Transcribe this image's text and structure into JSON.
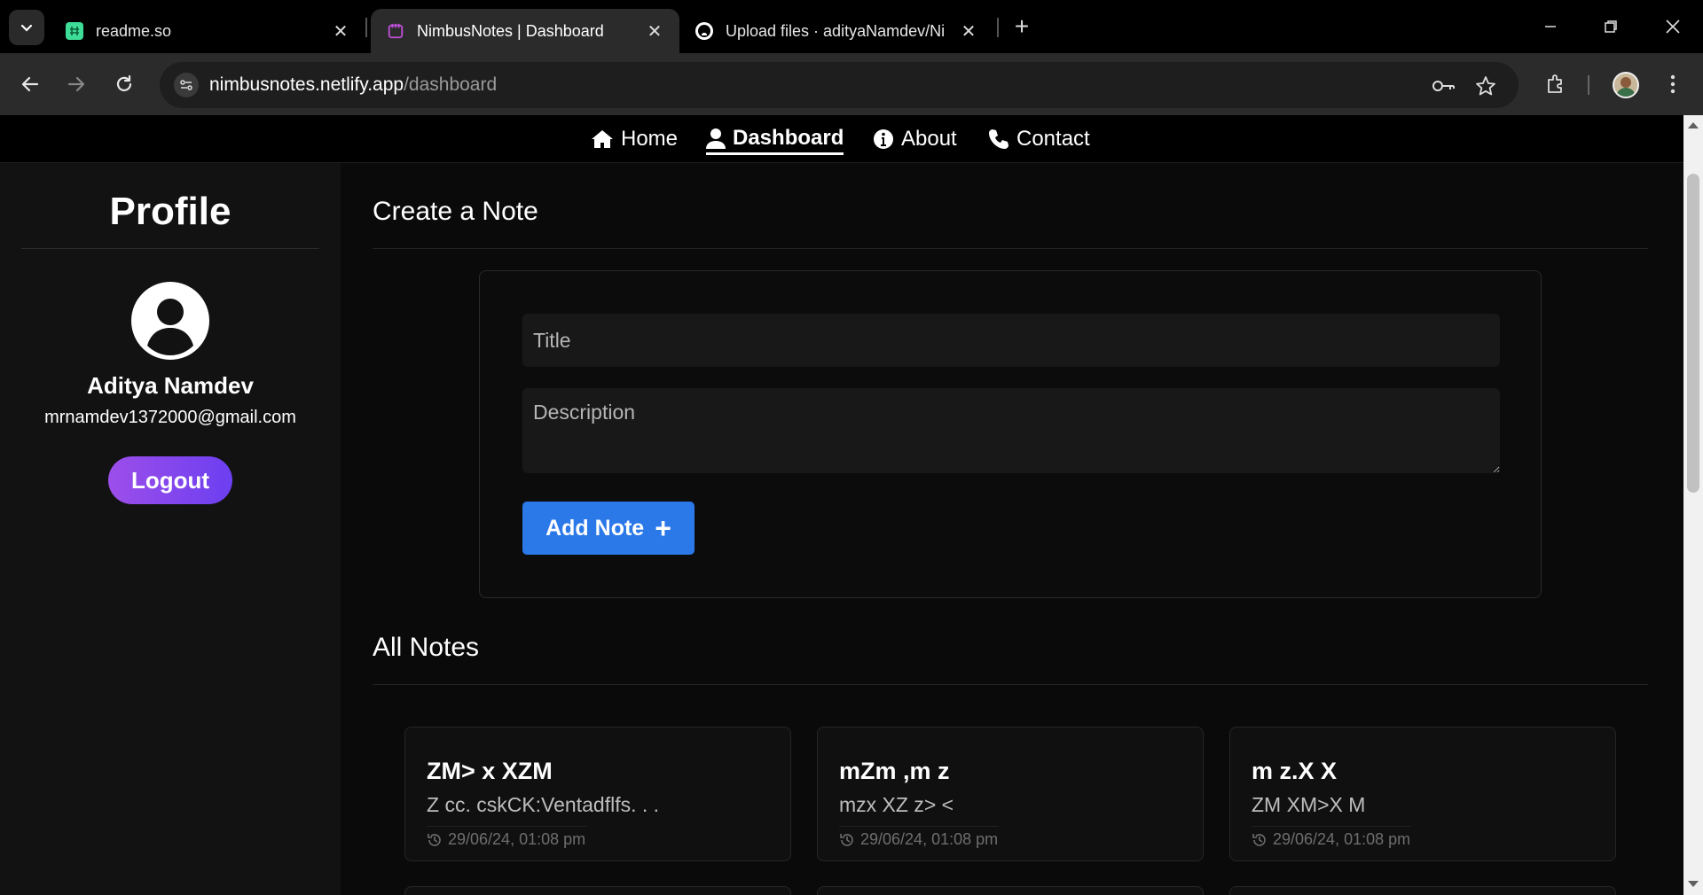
{
  "browser": {
    "tabs": [
      {
        "title": "readme.so",
        "close": "✕"
      },
      {
        "title": "NimbusNotes | Dashboard",
        "close": "✕"
      },
      {
        "title": "Upload files · adityaNamdev/Ni",
        "close": "✕"
      }
    ],
    "new_tab": "+",
    "url": {
      "domain": "nimbusnotes.netlify.app",
      "path": "/dashboard"
    }
  },
  "nav": {
    "home": "Home",
    "dashboard": "Dashboard",
    "about": "About",
    "contact": "Contact"
  },
  "profile": {
    "heading": "Profile",
    "name": "Aditya Namdev",
    "email": "mrnamdev1372000@gmail.com",
    "logout": "Logout"
  },
  "create": {
    "heading": "Create a Note",
    "title_placeholder": "Title",
    "desc_placeholder": "Description",
    "add_button": "Add Note",
    "add_icon": "+"
  },
  "all_notes": {
    "heading": "All Notes",
    "notes": [
      {
        "title": "ZM> x XZM",
        "description": "Z cc. cskCK:Ventadflfs. . .",
        "date": "29/06/24, 01:08 pm"
      },
      {
        "title": "mZm ,m z",
        "description": "mzx XZ z> <",
        "date": "29/06/24, 01:08 pm"
      },
      {
        "title": "m z.X X",
        "description": "ZM XM>X M",
        "date": "29/06/24, 01:08 pm"
      }
    ]
  },
  "colors": {
    "accent_blue": "#2b78e9",
    "logout_gradient_start": "#9d4eea",
    "logout_gradient_end": "#6c3ff0",
    "background": "#0a0a0a",
    "sidebar": "#121212"
  }
}
